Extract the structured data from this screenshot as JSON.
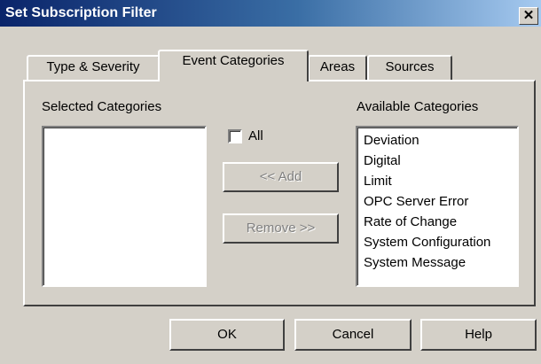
{
  "window": {
    "title": "Set Subscription Filter",
    "close_glyph": "✕",
    "close_icon": "close-icon"
  },
  "tabs": [
    {
      "label": "Type & Severity",
      "selected": false
    },
    {
      "label": "Event Categories",
      "selected": true
    },
    {
      "label": "Areas",
      "selected": false
    },
    {
      "label": "Sources",
      "selected": false
    }
  ],
  "selected_categories": {
    "label": "Selected Categories",
    "items": []
  },
  "all_checkbox": {
    "label": "All",
    "checked": false
  },
  "buttons": {
    "add": "<< Add",
    "remove": "Remove >>",
    "ok": "OK",
    "cancel": "Cancel",
    "help": "Help"
  },
  "available_categories": {
    "label": "Available Categories",
    "items": [
      "Deviation",
      "Digital",
      "Limit",
      "OPC Server Error",
      "Rate of Change",
      "System Configuration",
      "System Message"
    ]
  },
  "colors": {
    "face": "#d4d0c8",
    "title_start": "#0a246a",
    "title_end": "#a6caf0",
    "disabled_text": "#808080"
  }
}
